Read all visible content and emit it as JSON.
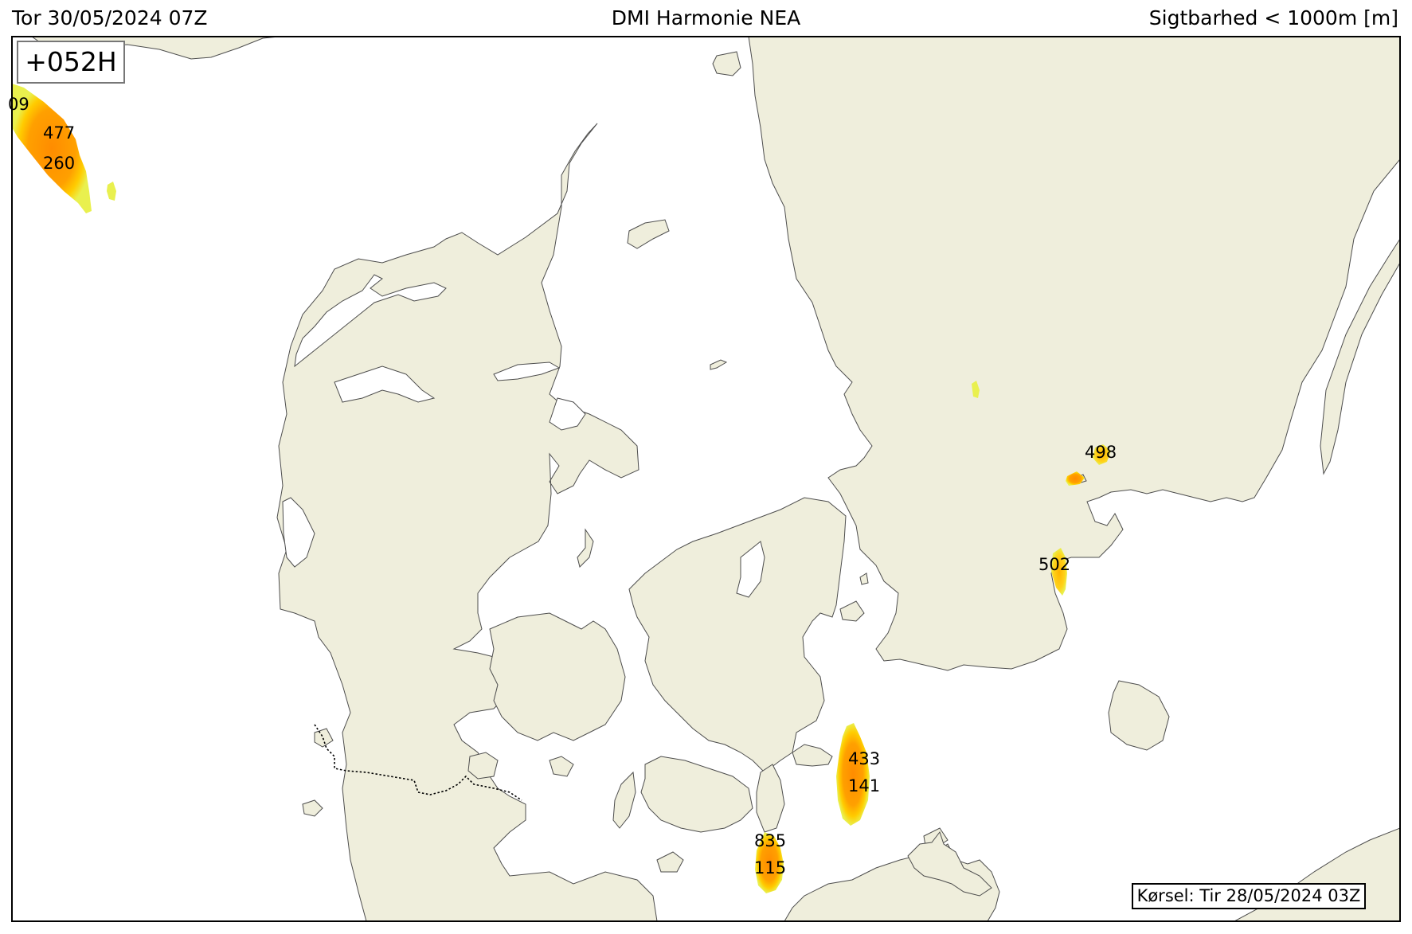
{
  "header": {
    "left": "Tor 30/05/2024 07Z",
    "center": "DMI Harmonie NEA",
    "right": "Sigtbarhed < 1000m [m]"
  },
  "lead_time": "+052H",
  "run_label": "Kørsel: Tir 28/05/2024 03Z",
  "colors": {
    "land": "#efeedc",
    "coast": "#4d4d4d",
    "fog_outer": "#eef04a",
    "fog_mid": "#ffc400",
    "fog_core": "#ff9400"
  },
  "visibility_labels": [
    {
      "id": "nw-1",
      "text": "09"
    },
    {
      "id": "nw-2",
      "text": "477"
    },
    {
      "id": "nw-3",
      "text": "260"
    },
    {
      "id": "sweden-1",
      "text": "498"
    },
    {
      "id": "sweden-2",
      "text": "502"
    },
    {
      "id": "baltic-1",
      "text": "433"
    },
    {
      "id": "baltic-2",
      "text": "141"
    },
    {
      "id": "fehmarn-1",
      "text": "835"
    },
    {
      "id": "fehmarn-2",
      "text": "115"
    }
  ]
}
